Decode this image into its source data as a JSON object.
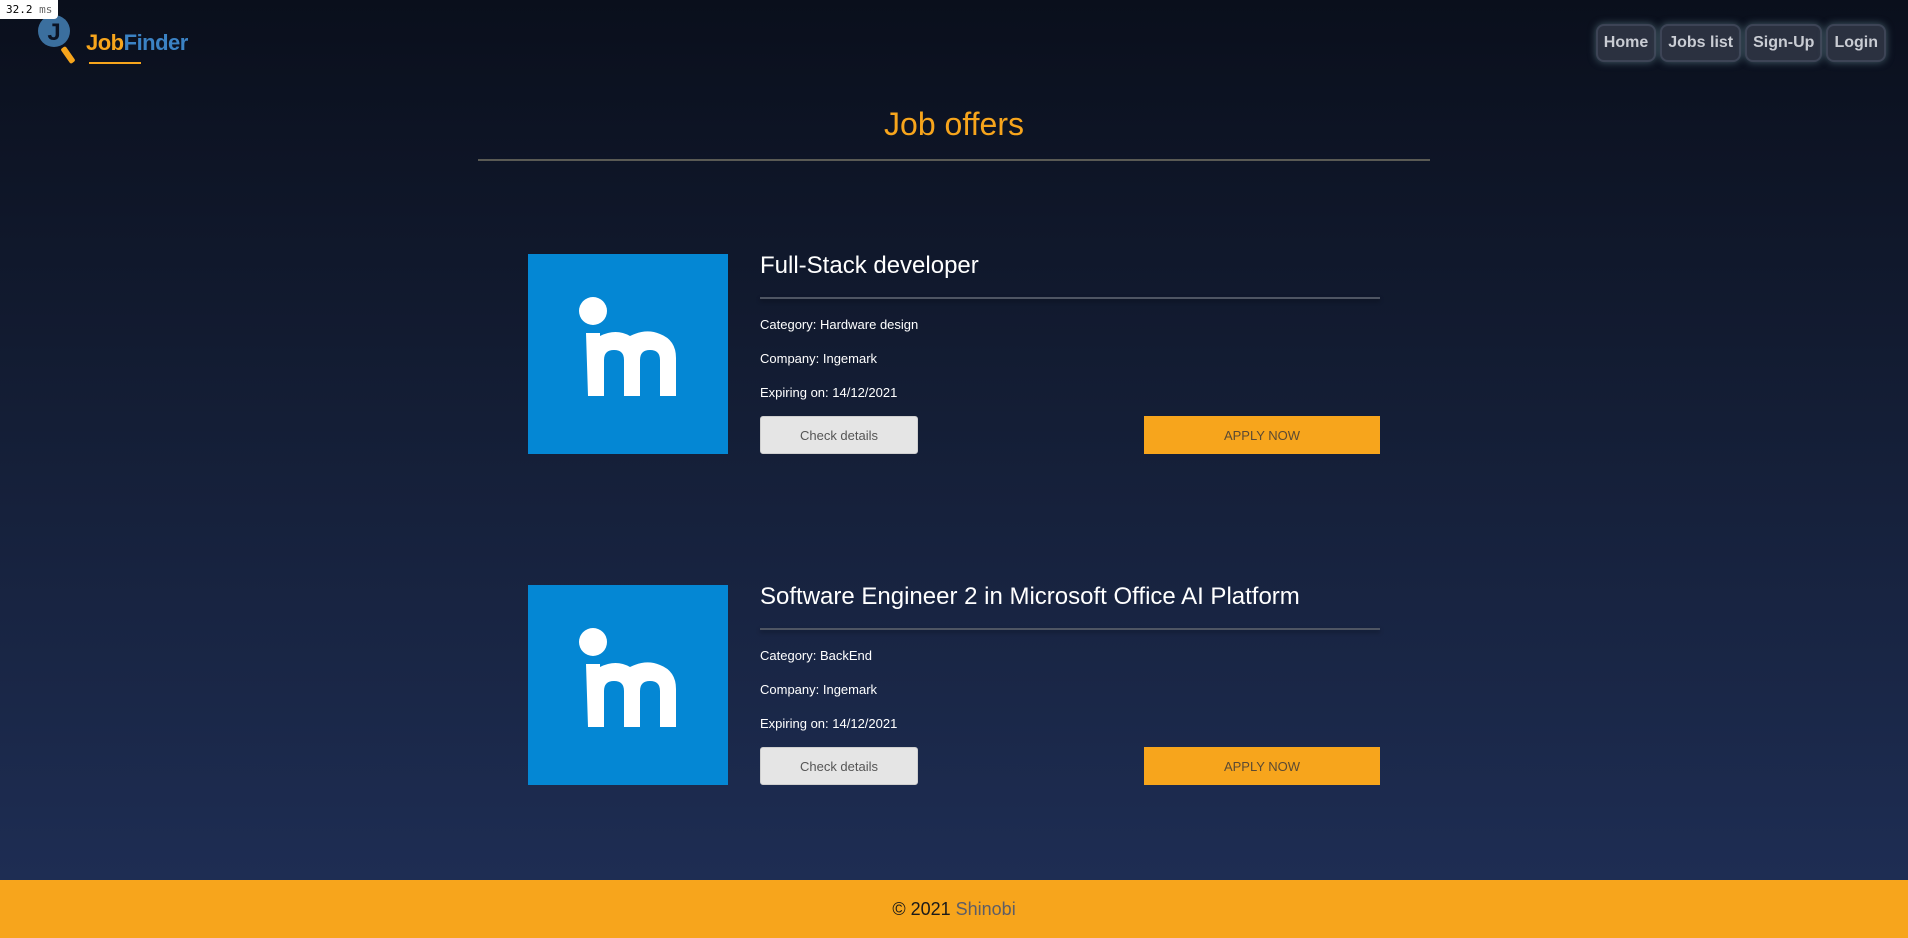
{
  "perf": {
    "value": "32.2",
    "unit": "ms"
  },
  "brand": {
    "job": "Job",
    "finder": "Finder"
  },
  "nav": [
    {
      "label": "Home"
    },
    {
      "label": "Jobs list"
    },
    {
      "label": "Sign-Up"
    },
    {
      "label": "Login"
    }
  ],
  "page_title": "Job offers",
  "jobs": [
    {
      "title": "Full-Stack developer",
      "category": "Category: Hardware design",
      "company": "Company: Ingemark",
      "expiring": "Expiring on: 14/12/2021",
      "details_label": "Check details",
      "apply_label": "APPLY NOW",
      "logo_icon": "ingemark-logo-icon"
    },
    {
      "title": "Software Engineer 2 in Microsoft Office AI Platform",
      "category": "Category: BackEnd",
      "company": "Company: Ingemark",
      "expiring": "Expiring on: 14/12/2021",
      "details_label": "Check details",
      "apply_label": "APPLY NOW",
      "logo_icon": "ingemark-logo-icon"
    }
  ],
  "footer": {
    "copyright": "© 2021",
    "brand": "Shinobi"
  },
  "colors": {
    "accent": "#f7a51c",
    "logo_blue": "#0487d4",
    "brand_blue": "#3b82c4"
  }
}
